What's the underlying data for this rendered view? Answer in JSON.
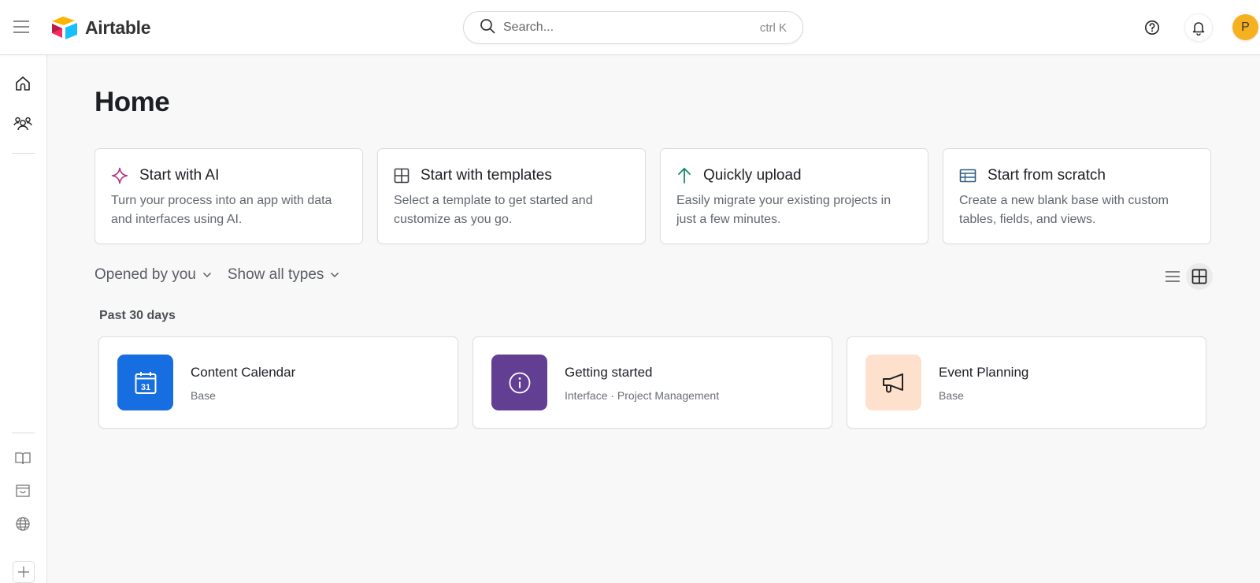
{
  "app": {
    "name": "Airtable",
    "menu_icon": "hamburger-icon"
  },
  "search": {
    "placeholder": "Search...",
    "shortcut": "ctrl K",
    "icon": "search-icon"
  },
  "header": {
    "help_icon": "help-icon",
    "notification_icon": "bell-icon",
    "avatar_initial": "P",
    "avatar_color": "#f5b120"
  },
  "sidebar": {
    "top_items": [
      {
        "name": "home",
        "icon": "home-icon"
      },
      {
        "name": "workspaces",
        "icon": "users-icon"
      }
    ],
    "bottom_items": [
      {
        "name": "templates-and-apps",
        "icon": "book-icon"
      },
      {
        "name": "marketplace",
        "icon": "inbox-icon"
      },
      {
        "name": "universe",
        "icon": "globe-icon"
      },
      {
        "name": "create",
        "icon": "plus-icon"
      }
    ]
  },
  "page": {
    "title": "Home"
  },
  "start_cards": [
    {
      "title": "Start with AI",
      "description": "Turn your process into an app with data and interfaces using AI.",
      "icon": "sparkle-icon",
      "icon_color": "#b0308a"
    },
    {
      "title": "Start with templates",
      "description": "Select a template to get started and customize as you go.",
      "icon": "grid-icon",
      "icon_color": "#3a3d45"
    },
    {
      "title": "Quickly upload",
      "description": "Easily migrate your existing projects in just a few minutes.",
      "icon": "arrow-up-icon",
      "icon_color": "#0d8a6a"
    },
    {
      "title": "Start from scratch",
      "description": "Create a new blank base with custom tables, fields, and views.",
      "icon": "table-icon",
      "icon_color": "#2f5f86"
    }
  ],
  "filters": {
    "opened_by": "Opened by you",
    "type": "Show all types"
  },
  "view": {
    "list_icon": "list-view-icon",
    "grid_icon": "grid-view-icon",
    "active": "grid"
  },
  "recent": {
    "section_label": "Past 30 days",
    "items": [
      {
        "name": "Content Calendar",
        "meta": "Base",
        "icon": "calendar-icon",
        "tile_color": "#166ee1",
        "icon_text": "31"
      },
      {
        "name": "Getting started",
        "meta": "Interface · Project Management",
        "icon": "info-icon",
        "tile_color": "#633f93"
      },
      {
        "name": "Event Planning",
        "meta": "Base",
        "icon": "megaphone-icon",
        "tile_color": "#fde1cd"
      }
    ]
  }
}
